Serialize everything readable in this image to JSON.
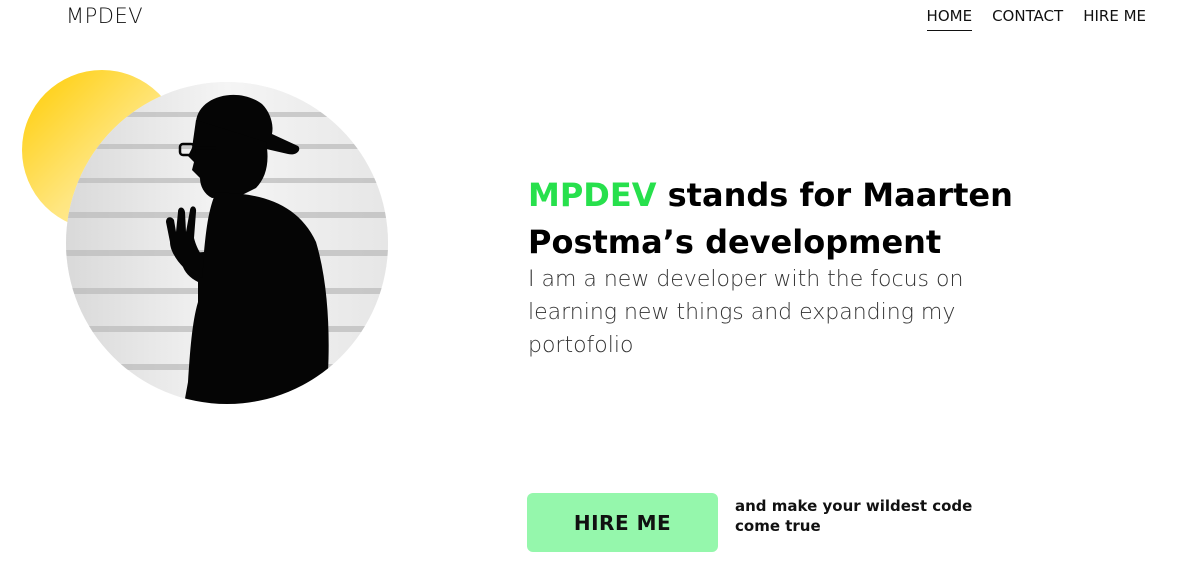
{
  "header": {
    "logo": "MPDEV",
    "nav": [
      {
        "label": "HOME",
        "active": true
      },
      {
        "label": "CONTACT",
        "active": false
      },
      {
        "label": "HIRE ME",
        "active": false
      }
    ]
  },
  "hero": {
    "headline_brand": "MPDEV",
    "headline_rest": " stands for Maarten Postma’s development",
    "intro_before": "I am a new developer with the ",
    "intro_highlight": "focus",
    "intro_after": " on learning new things and expanding my portofolio",
    "cta_label": "HIRE ME",
    "cta_note": "and make your wildest code come true"
  },
  "colors": {
    "brand_green": "#27e04c",
    "highlight_green": "#39e65a",
    "button_green": "#95f7ac",
    "sun_yellow": "#ffcc00"
  },
  "icons": {
    "photo": "developer-silhouette-photo"
  }
}
